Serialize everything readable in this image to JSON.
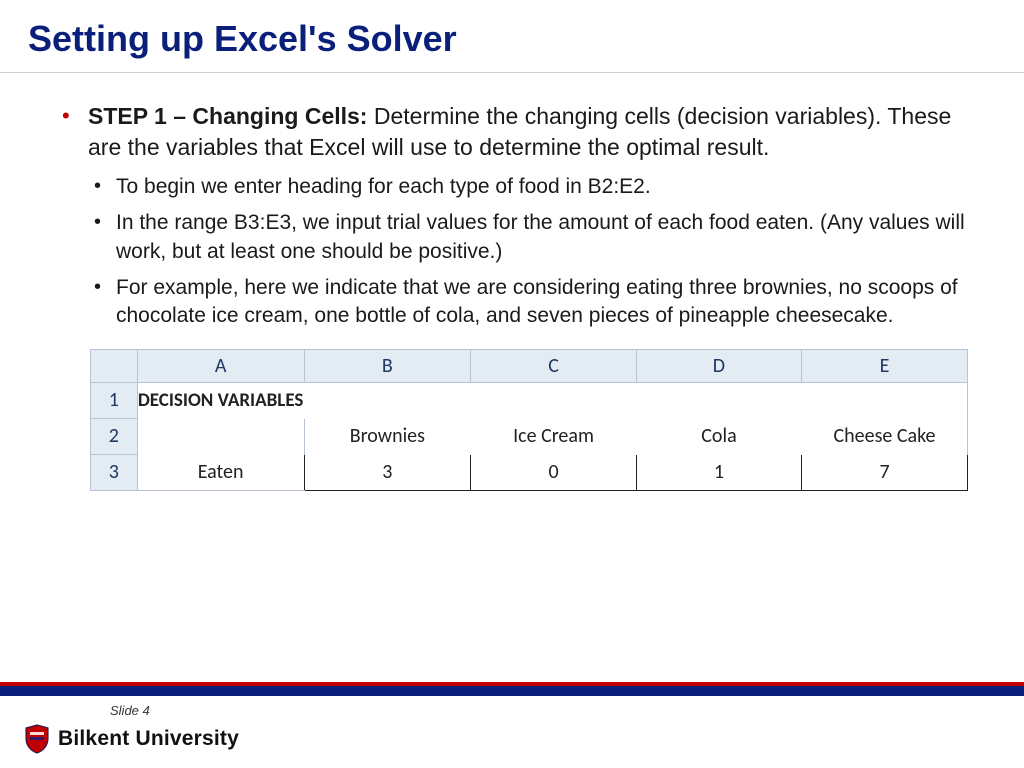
{
  "title": "Setting up Excel's Solver",
  "step1": {
    "label": "STEP 1 – Changing Cells:",
    "text": " Determine the changing cells (decision variables). These are the variables that Excel will use to determine the optimal result.",
    "sub": [
      "To begin we enter heading for each type of food in B2:E2.",
      "In the range B3:E3, we input trial values for the amount of each food eaten. (Any values will work, but at least one should be positive.)",
      "For example, here we indicate that we are considering eating three brownies, no scoops of chocolate ice cream, one bottle of cola, and seven pieces of pineapple cheesecake."
    ]
  },
  "sheet": {
    "cols": [
      "A",
      "B",
      "C",
      "D",
      "E"
    ],
    "rowhdr": [
      "1",
      "2",
      "3"
    ],
    "a1": "DECISION VARIABLES",
    "row2": {
      "A": "",
      "B": "Brownies",
      "C": "Ice Cream",
      "D": "Cola",
      "E": "Cheese Cake"
    },
    "row3": {
      "A": "Eaten",
      "B": "3",
      "C": "0",
      "D": "1",
      "E": "7"
    }
  },
  "slide_label": "Slide 4",
  "university": "Bilkent University"
}
